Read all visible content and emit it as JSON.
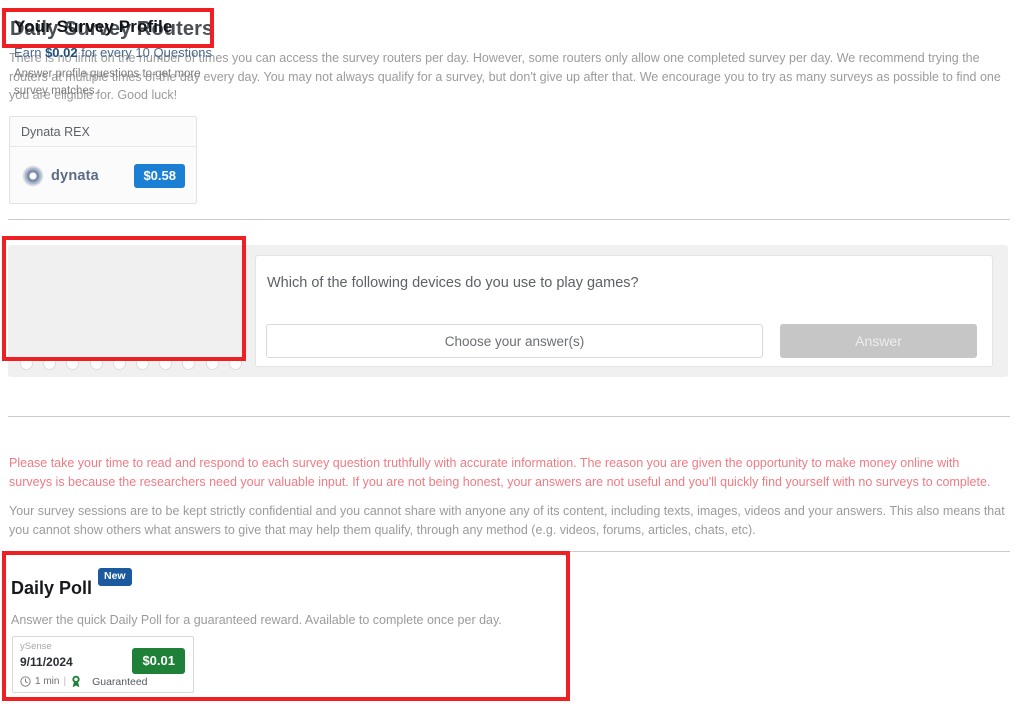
{
  "routers": {
    "title": "Daily Survey Routers",
    "description": "There is no limit on the number of times you can access the survey routers per day. However, some routers only allow one completed survey per day. We recommend trying the routers at multiple times of the day every day. You may not always qualify for a survey, but don't give up after that. We encourage you to try as many surveys as possible to find one you are eligible for. Good luck!",
    "card": {
      "name": "Dynata REX",
      "provider_logo_text": "dynata",
      "price": "$0.58",
      "price_color": "#1b7fd4"
    }
  },
  "profile": {
    "heading": "Your Survey Profile",
    "earn_prefix": "Earn ",
    "earn_amount": "$0.02",
    "earn_suffix": " for every 10 Questions",
    "subtext": "Answer profile questions to get more survey matches.",
    "progress_dots": 10,
    "question": {
      "text": "Which of the following devices do you use to play games?",
      "select_placeholder": "Choose your answer(s)",
      "submit_label": "Answer"
    }
  },
  "notices": {
    "warning": "Please take your time to read and respond to each survey question truthfully with accurate information. The reason you are given the opportunity to make money online with surveys is because the researchers need your valuable input. If you are not being honest, your answers are not useful and you'll quickly find yourself with no surveys to complete.",
    "warning_color": "#ef7b84",
    "confidential": "Your survey sessions are to be kept strictly confidential and you cannot share with anyone any of its content, including texts, images, videos and your answers. This also means that you cannot show others what answers to give that may help them qualify, through any method (e.g. videos, forums, articles, chats, etc)."
  },
  "daily_poll": {
    "title": "Daily Poll",
    "badge": "New",
    "badge_color": "#1b5a9e",
    "description": "Answer the quick Daily Poll for a guaranteed reward. Available to complete once per day.",
    "card": {
      "provider": "ySense",
      "date": "9/11/2024",
      "duration": "1 min",
      "reward_type": "Guaranteed",
      "price": "$0.01",
      "price_color": "#1f8037"
    }
  }
}
